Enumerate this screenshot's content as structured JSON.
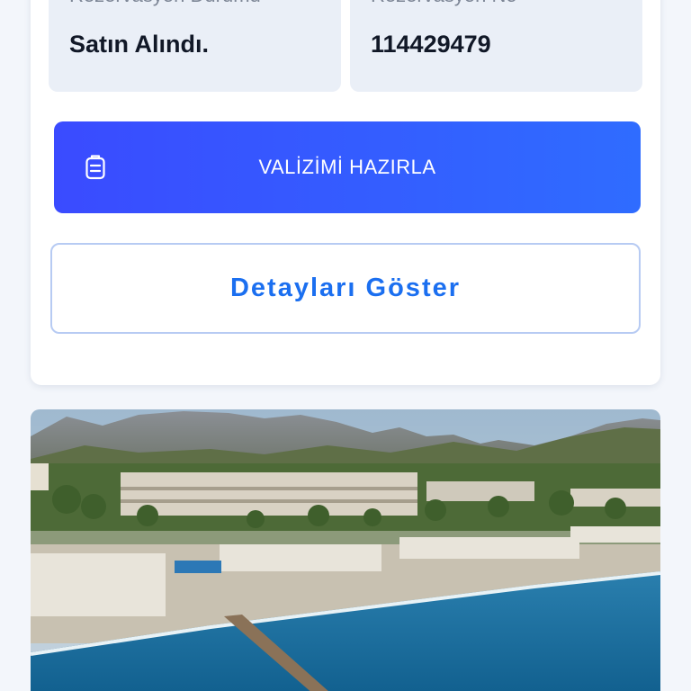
{
  "reservation": {
    "status_label": "Rezervasyon Durumu",
    "status_value": "Satın Alındı.",
    "number_label": "Rezervasyon No",
    "number_value": "114429479"
  },
  "actions": {
    "pack_button_label": "VALİZİMİ HAZIRLA",
    "pack_button_icon": "luggage-icon",
    "details_button_label": "Detayları Göster"
  },
  "colors": {
    "primary_gradient_start": "#3a4bff",
    "primary_gradient_end": "#2f6cff",
    "outline_border": "#b7cbf3",
    "outline_text": "#1b6ff0",
    "info_box_bg": "#eaeff7"
  }
}
